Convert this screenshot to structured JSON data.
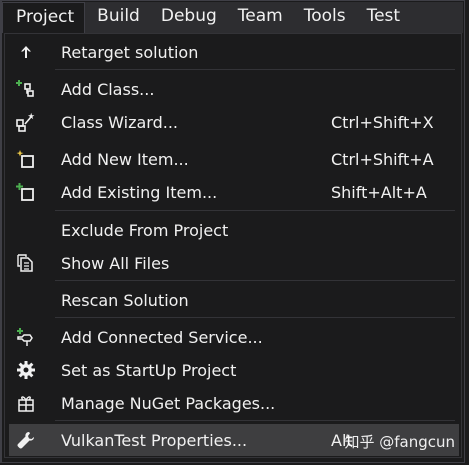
{
  "menubar": {
    "items": [
      {
        "label": "Project",
        "active": true
      },
      {
        "label": "Build",
        "active": false
      },
      {
        "label": "Debug",
        "active": false
      },
      {
        "label": "Team",
        "active": false
      },
      {
        "label": "Tools",
        "active": false
      },
      {
        "label": "Test",
        "active": false
      }
    ]
  },
  "menu": {
    "items": [
      {
        "label": "Retarget solution",
        "shortcut": "",
        "icon": "arrow-up-icon"
      },
      {
        "label": "Add Class...",
        "shortcut": "",
        "icon": "add-class-icon"
      },
      {
        "label": "Class Wizard...",
        "shortcut": "Ctrl+Shift+X",
        "icon": "class-wizard-icon"
      },
      {
        "label": "Add New Item...",
        "shortcut": "Ctrl+Shift+A",
        "icon": "add-new-item-icon"
      },
      {
        "label": "Add Existing Item...",
        "shortcut": "Shift+Alt+A",
        "icon": "add-existing-item-icon"
      },
      {
        "label": "Exclude From Project",
        "shortcut": "",
        "icon": ""
      },
      {
        "label": "Show All Files",
        "shortcut": "",
        "icon": "show-all-files-icon"
      },
      {
        "label": "Rescan Solution",
        "shortcut": "",
        "icon": ""
      },
      {
        "label": "Add Connected Service...",
        "shortcut": "",
        "icon": "connected-service-icon"
      },
      {
        "label": "Set as StartUp Project",
        "shortcut": "",
        "icon": "gear-icon"
      },
      {
        "label": "Manage NuGet Packages...",
        "shortcut": "",
        "icon": "nuget-package-icon"
      },
      {
        "label": "VulkanTest Properties...",
        "shortcut": "Alt",
        "icon": "wrench-icon",
        "highlighted": true
      }
    ]
  },
  "watermark": {
    "text": "知乎 @fangcun"
  },
  "colors": {
    "background": "#1b1b1c",
    "menubar": "#2d2d30",
    "highlight": "#3e3e40",
    "text": "#f1f1f1",
    "accent_green": "#4caf50"
  }
}
